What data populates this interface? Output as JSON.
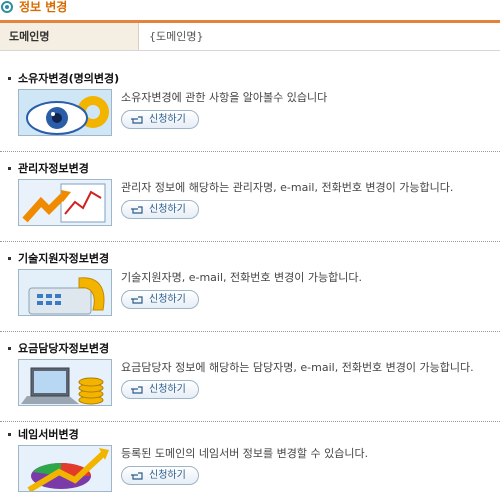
{
  "header": {
    "title": "정보 변경"
  },
  "domain_row": {
    "label": "도메인명",
    "value": "{도메인명}"
  },
  "items": [
    {
      "title": "소유자변경(명의변경)",
      "desc": "소유자변경에 관한 사항을 알아볼수 있습니다",
      "button": "신청하기",
      "icon": "eye-gear-icon"
    },
    {
      "title": "관리자정보변경",
      "desc": "관리자 정보에 해당하는 관리자명, e-mail, 전화번호 변경이 가능합니다.",
      "button": "신청하기",
      "icon": "chart-arrow-icon"
    },
    {
      "title": "기술지원자정보변경",
      "desc": "기술지원자명, e-mail, 전화번호 변경이 가능합니다.",
      "button": "신청하기",
      "icon": "phone-keypad-icon"
    },
    {
      "title": "요금담당자정보변경",
      "desc": "요금담당자 정보에 해당하는 담당자명, e-mail, 전화번호 변경이 가능합니다.",
      "button": "신청하기",
      "icon": "laptop-coins-icon"
    },
    {
      "title": "네임서버변경",
      "desc": "등록된 도메인의 네임서버 정보를 변경할 수 있습니다.",
      "button": "신청하기",
      "icon": "pie-chart-arrow-icon"
    }
  ]
}
